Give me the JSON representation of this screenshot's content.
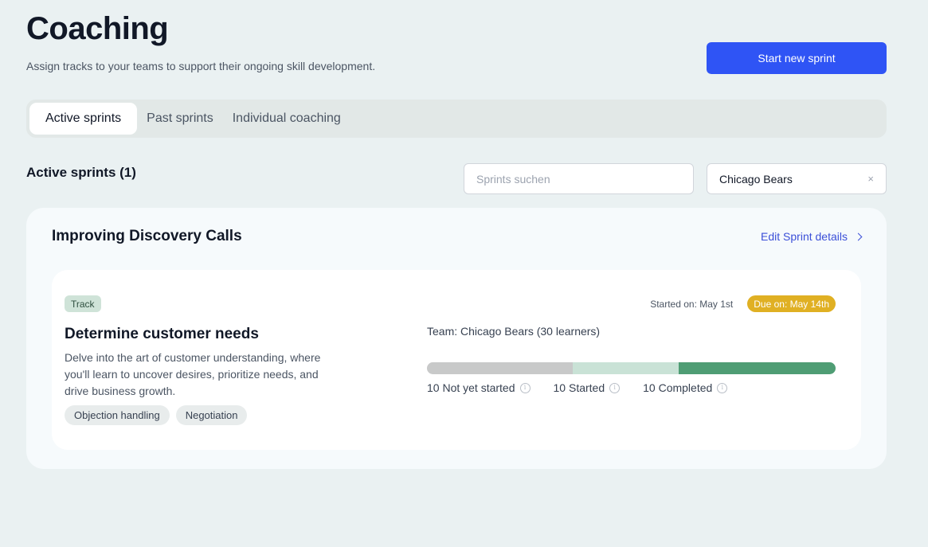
{
  "header": {
    "title": "Coaching",
    "subtitle": "Assign tracks to your teams to support their ongoing skill development.",
    "primary_action": "Start new sprint"
  },
  "tabs": [
    {
      "label": "Active sprints",
      "active": true
    },
    {
      "label": "Past sprints",
      "active": false
    },
    {
      "label": "Individual coaching",
      "active": false
    }
  ],
  "filters": {
    "section_title": "Active sprints (1)",
    "search": {
      "placeholder": "Sprints suchen",
      "value": ""
    },
    "team_select": {
      "value": "Chicago Bears",
      "clear_icon": "×"
    }
  },
  "sprint": {
    "title": "Improving Discovery Calls",
    "edit_label": "Edit Sprint details",
    "track": {
      "badge": "Track",
      "title": "Determine customer needs",
      "description": "Delve into the art of customer understanding, where you'll learn to uncover desires, prioritize needs, and drive business growth.",
      "skills": [
        "Objection handling",
        "Negotiation"
      ],
      "started_on": "Started on: May 1st",
      "due_on": "Due on: May 14th",
      "team": "Team: Chicago Bears (30 learners)",
      "progress": [
        {
          "label": "10 Not yet started",
          "count": 10,
          "color": "#c8c9c9"
        },
        {
          "label": "10 Started",
          "count": 10,
          "color": "#c9e2d6"
        },
        {
          "label": "10 Completed",
          "count": 10,
          "color": "#4f9d74"
        }
      ]
    }
  },
  "colors": {
    "primary": "#2f54f5",
    "link": "#3b4fd8",
    "due_badge": "#e0b023",
    "track_badge": "#cfe3d8",
    "background": "#eaf1f2"
  },
  "icons": {
    "clear": "clear-icon",
    "chevron": "chevron-right-icon",
    "info": "info-icon"
  }
}
